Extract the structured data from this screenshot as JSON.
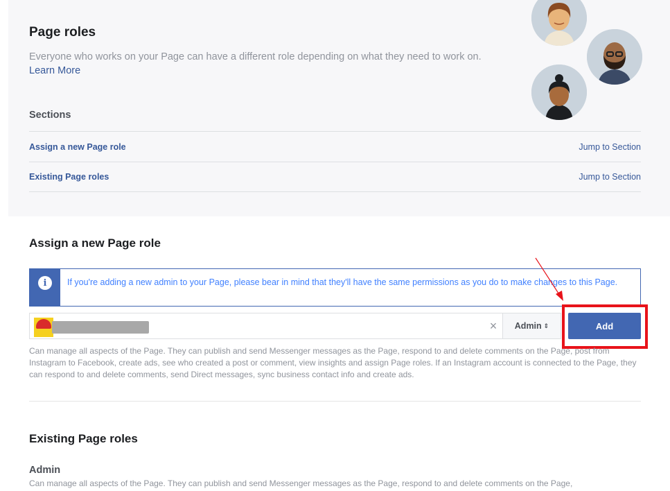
{
  "header": {
    "title": "Page roles",
    "intro_text": "Everyone who works on your Page can have a different role depending on what they need to work on.",
    "learn_more": "Learn More"
  },
  "sections": {
    "heading": "Sections",
    "items": [
      {
        "label": "Assign a new Page role",
        "jump": "Jump to Section"
      },
      {
        "label": "Existing Page roles",
        "jump": "Jump to Section"
      }
    ]
  },
  "avatars": [
    {
      "icon": "person-avatar-icon",
      "bg": "#c9d3dc"
    },
    {
      "icon": "bearded-person-avatar-icon",
      "bg": "#c9d3dc"
    },
    {
      "icon": "person-bun-avatar-icon",
      "bg": "#c9d3dc"
    }
  ],
  "assign": {
    "heading": "Assign a new Page role",
    "notice": "If you're adding a new admin to your Page, please bear in mind that they'll have the same permissions as you do to make changes to this Page.",
    "clear_icon": "×",
    "role_value": "Admin",
    "role_chevron": "⇕",
    "add_label": "Add",
    "role_description": "Can manage all aspects of the Page. They can publish and send Messenger messages as the Page, respond to and delete comments on the Page, post from Instagram to Facebook, create ads, see who created a post or comment, view insights and assign Page roles. If an Instagram account is connected to the Page, they can respond to and delete comments, send Direct messages, sync business contact info and create ads."
  },
  "existing": {
    "heading": "Existing Page roles",
    "role_label": "Admin",
    "role_description": "Can manage all aspects of the Page. They can publish and send Messenger messages as the Page, respond to and delete comments on the Page,"
  },
  "colors": {
    "brand_blue": "#4267b2",
    "link_blue": "#365899",
    "notice_text": "#4080ff",
    "highlight_red": "#e8131a"
  }
}
